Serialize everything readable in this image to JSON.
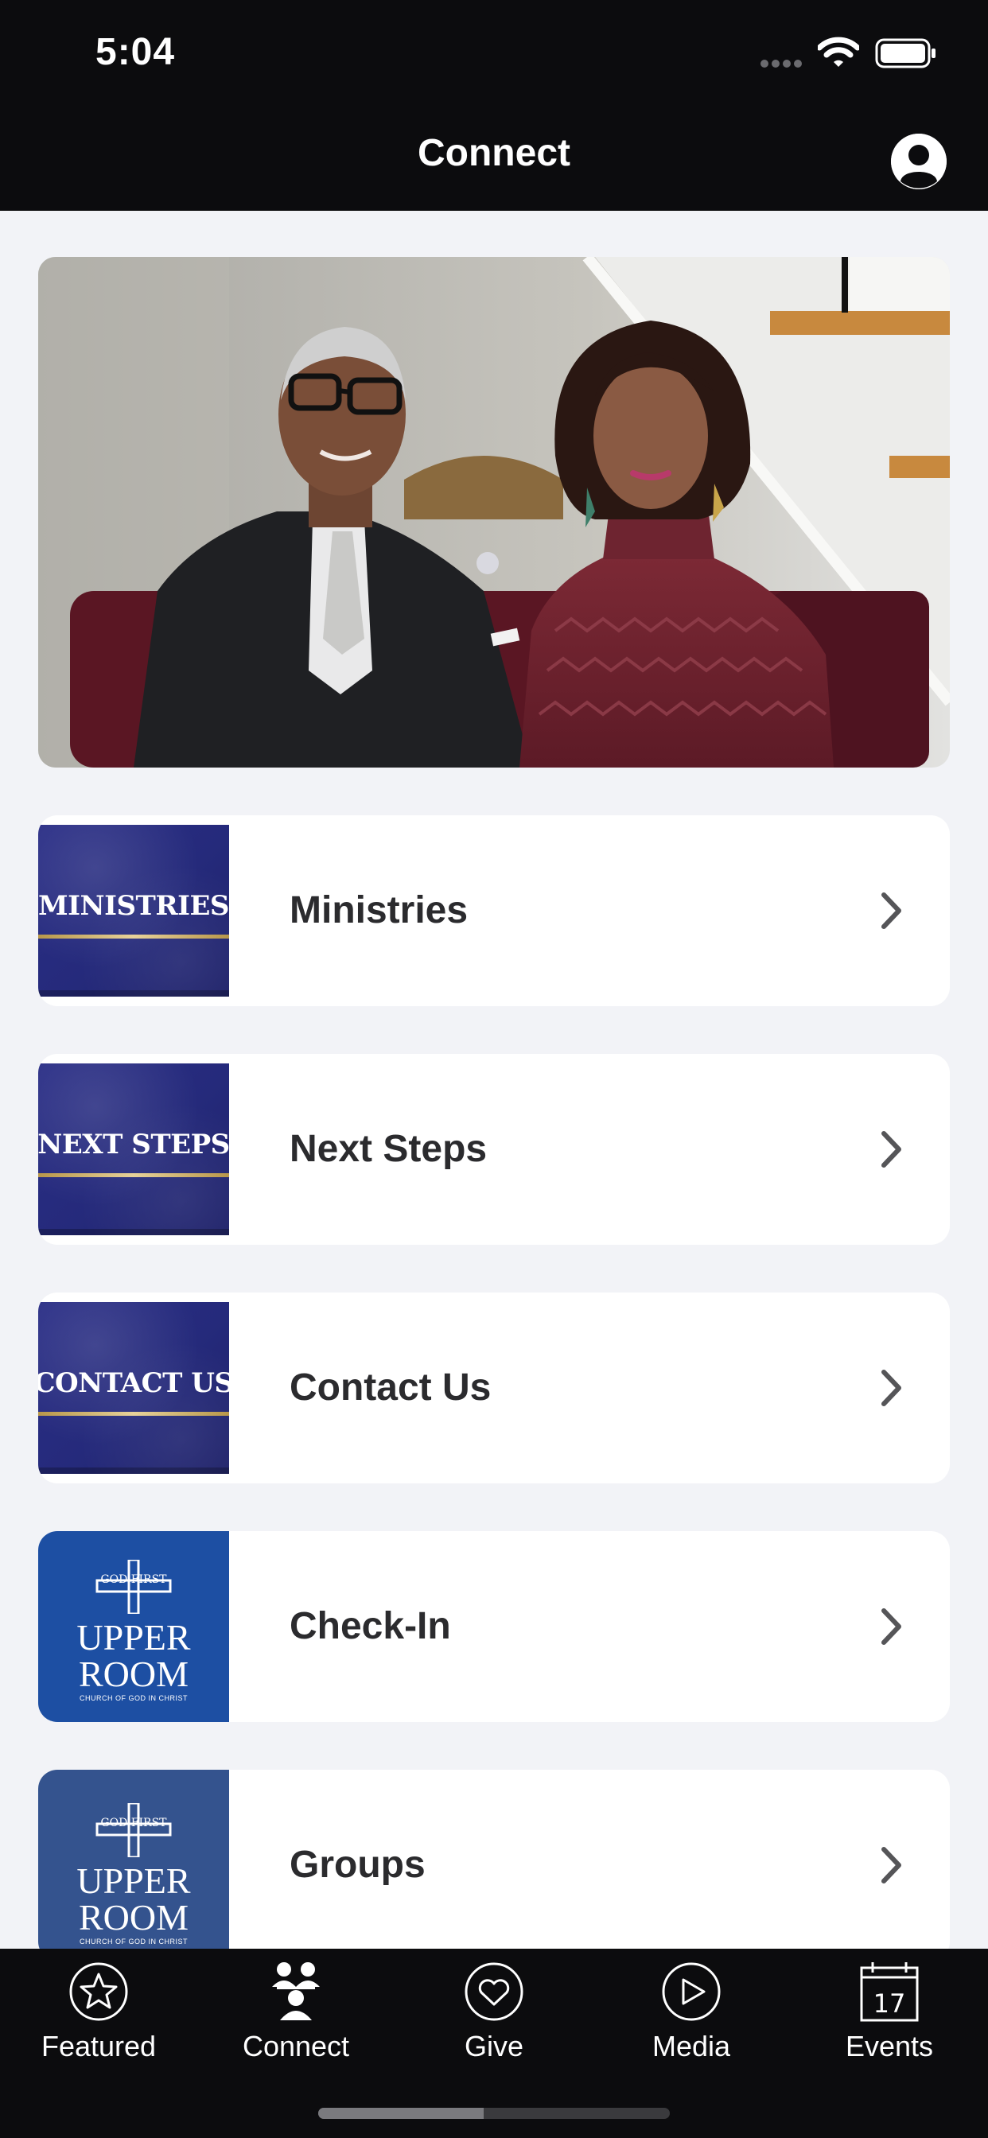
{
  "status_bar": {
    "time": "5:04"
  },
  "nav": {
    "title": "Connect"
  },
  "items": [
    {
      "label": "Ministries",
      "thumb_text": "MINISTRIES"
    },
    {
      "label": "Next Steps",
      "thumb_text": "NEXT STEPS"
    },
    {
      "label": "Contact Us",
      "thumb_text": "CONTACT US"
    },
    {
      "label": "Check-In",
      "logo_top": "GOD FIRST",
      "logo_main_1": "UPPER",
      "logo_main_2": "ROOM",
      "logo_sub": "CHURCH OF GOD IN CHRIST"
    },
    {
      "label": "Groups",
      "logo_top": "GOD FIRST",
      "logo_main_1": "UPPER",
      "logo_main_2": "ROOM",
      "logo_sub": "CHURCH OF GOD IN CHRIST"
    }
  ],
  "tabs": [
    {
      "label": "Featured",
      "icon": "star-icon",
      "active": false
    },
    {
      "label": "Connect",
      "icon": "people-icon",
      "active": true
    },
    {
      "label": "Give",
      "icon": "heart-icon",
      "active": false
    },
    {
      "label": "Media",
      "icon": "play-icon",
      "active": false
    },
    {
      "label": "Events",
      "icon": "calendar-icon",
      "active": false,
      "badge": "17"
    }
  ],
  "colors": {
    "bar_background": "#0c0c0e",
    "page_background": "#f2f3f7",
    "banner_blue": "#2a2e86",
    "logo_blue": "#1d4fa3",
    "text_dark": "#2b2b2e"
  }
}
